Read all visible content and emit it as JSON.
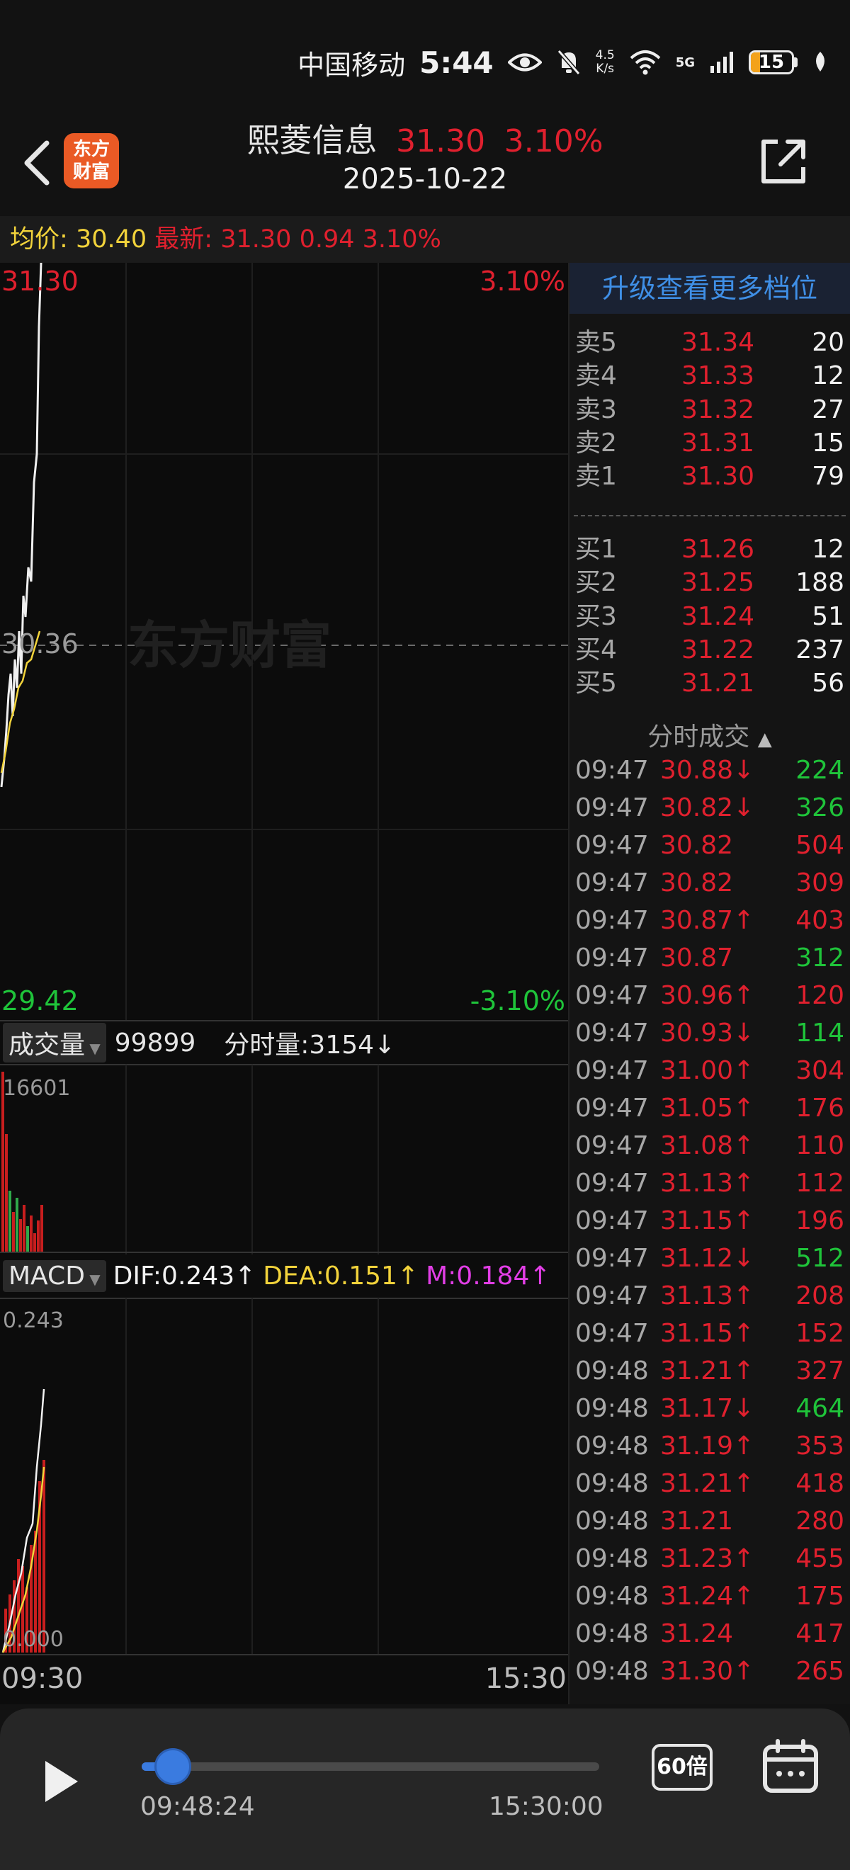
{
  "status": {
    "carrier": "中国移动",
    "time": "5:44",
    "net_speed_value": "4.5",
    "net_speed_unit": "K/s",
    "battery": "15",
    "battery_level": 0.15
  },
  "header": {
    "stock_name": "熙菱信息",
    "price": "31.30",
    "change_pct": "3.10%",
    "date": "2025-10-22",
    "logo_line1": "东方",
    "logo_line2": "财富"
  },
  "infobar": {
    "avg_label": "均价:",
    "avg_value": "30.40",
    "latest_label": "最新:",
    "latest_price": "31.30",
    "change": "0.94",
    "change_pct": "3.10%"
  },
  "price_chart": {
    "top_price": "31.30",
    "top_pct": "3.10%",
    "mid_price": "30.36",
    "bottom_price": "29.42",
    "bottom_pct": "-3.10%",
    "watermark": "东方财富",
    "line_color": "#f0f0f0",
    "avg_line_color": "#f2d33b"
  },
  "volume_chart": {
    "selector": "成交量",
    "total": "99899",
    "sub_label": "分时量:3154↓",
    "max_label": "16601"
  },
  "macd_chart": {
    "selector": "MACD",
    "dif": "DIF:0.243↑",
    "dea": "DEA:0.151↑",
    "m": "M:0.184↑",
    "top_label": "0.243",
    "bottom_label": "0.000"
  },
  "time_axis": {
    "start": "09:30",
    "end": "15:30"
  },
  "orderbook": {
    "upgrade_label": "升级查看更多档位",
    "asks": [
      {
        "label": "卖5",
        "price": "31.34",
        "vol": "20"
      },
      {
        "label": "卖4",
        "price": "31.33",
        "vol": "12"
      },
      {
        "label": "卖3",
        "price": "31.32",
        "vol": "27"
      },
      {
        "label": "卖2",
        "price": "31.31",
        "vol": "15"
      },
      {
        "label": "卖1",
        "price": "31.30",
        "vol": "79"
      }
    ],
    "bids": [
      {
        "label": "买1",
        "price": "31.26",
        "vol": "12"
      },
      {
        "label": "买2",
        "price": "31.25",
        "vol": "188"
      },
      {
        "label": "买3",
        "price": "31.24",
        "vol": "51"
      },
      {
        "label": "买4",
        "price": "31.22",
        "vol": "237"
      },
      {
        "label": "买5",
        "price": "31.21",
        "vol": "56"
      }
    ]
  },
  "trades": {
    "header": "分时成交",
    "rows": [
      {
        "time": "09:47",
        "price": "30.88↓",
        "vol": "224",
        "pc": "red",
        "vc": "green"
      },
      {
        "time": "09:47",
        "price": "30.82↓",
        "vol": "326",
        "pc": "red",
        "vc": "green"
      },
      {
        "time": "09:47",
        "price": "30.82",
        "vol": "504",
        "pc": "red",
        "vc": "red"
      },
      {
        "time": "09:47",
        "price": "30.82",
        "vol": "309",
        "pc": "red",
        "vc": "red"
      },
      {
        "time": "09:47",
        "price": "30.87↑",
        "vol": "403",
        "pc": "red",
        "vc": "red"
      },
      {
        "time": "09:47",
        "price": "30.87",
        "vol": "312",
        "pc": "red",
        "vc": "green"
      },
      {
        "time": "09:47",
        "price": "30.96↑",
        "vol": "120",
        "pc": "red",
        "vc": "red"
      },
      {
        "time": "09:47",
        "price": "30.93↓",
        "vol": "114",
        "pc": "red",
        "vc": "green"
      },
      {
        "time": "09:47",
        "price": "31.00↑",
        "vol": "304",
        "pc": "red",
        "vc": "red"
      },
      {
        "time": "09:47",
        "price": "31.05↑",
        "vol": "176",
        "pc": "red",
        "vc": "red"
      },
      {
        "time": "09:47",
        "price": "31.08↑",
        "vol": "110",
        "pc": "red",
        "vc": "red"
      },
      {
        "time": "09:47",
        "price": "31.13↑",
        "vol": "112",
        "pc": "red",
        "vc": "red"
      },
      {
        "time": "09:47",
        "price": "31.15↑",
        "vol": "196",
        "pc": "red",
        "vc": "red"
      },
      {
        "time": "09:47",
        "price": "31.12↓",
        "vol": "512",
        "pc": "red",
        "vc": "green"
      },
      {
        "time": "09:47",
        "price": "31.13↑",
        "vol": "208",
        "pc": "red",
        "vc": "red"
      },
      {
        "time": "09:47",
        "price": "31.15↑",
        "vol": "152",
        "pc": "red",
        "vc": "red"
      },
      {
        "time": "09:48",
        "price": "31.21↑",
        "vol": "327",
        "pc": "red",
        "vc": "red"
      },
      {
        "time": "09:48",
        "price": "31.17↓",
        "vol": "464",
        "pc": "red",
        "vc": "green"
      },
      {
        "time": "09:48",
        "price": "31.19↑",
        "vol": "353",
        "pc": "red",
        "vc": "red"
      },
      {
        "time": "09:48",
        "price": "31.21↑",
        "vol": "418",
        "pc": "red",
        "vc": "red"
      },
      {
        "time": "09:48",
        "price": "31.21",
        "vol": "280",
        "pc": "red",
        "vc": "red"
      },
      {
        "time": "09:48",
        "price": "31.23↑",
        "vol": "455",
        "pc": "red",
        "vc": "red"
      },
      {
        "time": "09:48",
        "price": "31.24↑",
        "vol": "175",
        "pc": "red",
        "vc": "red"
      },
      {
        "time": "09:48",
        "price": "31.24",
        "vol": "417",
        "pc": "red",
        "vc": "red"
      },
      {
        "time": "09:48",
        "price": "31.30↑",
        "vol": "265",
        "pc": "red",
        "vc": "red"
      }
    ]
  },
  "playback": {
    "current_time": "09:48:24",
    "end_time": "15:30:00",
    "speed": "60倍",
    "progress": 0.04
  }
}
